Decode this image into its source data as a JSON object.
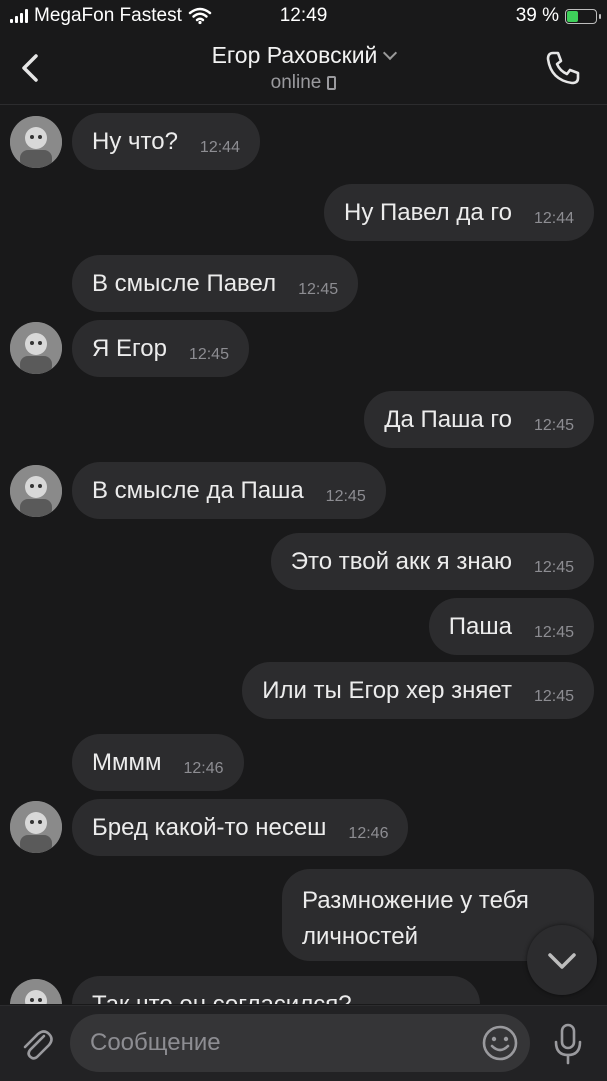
{
  "status_bar": {
    "carrier": "MegaFon Fastest",
    "time": "12:49",
    "battery_percent": "39 %",
    "battery_level": 0.39,
    "icons": [
      "signal-icon",
      "wifi-icon",
      "battery-icon"
    ]
  },
  "header": {
    "contact_name": "Егор Раховский",
    "status": "online",
    "icons": [
      "back-arrow-icon",
      "chevron-down-icon",
      "phone-device-icon",
      "call-icon"
    ]
  },
  "messages": [
    {
      "side": "in",
      "text": "Ну что?",
      "time": "12:44",
      "avatar": true
    },
    {
      "side": "out",
      "text": "Ну Павел да го",
      "time": "12:44"
    },
    {
      "side": "in",
      "text": "В смысле Павел",
      "time": "12:45"
    },
    {
      "side": "in",
      "text": "Я Егор",
      "time": "12:45",
      "avatar": true
    },
    {
      "side": "out",
      "text": "Да Паша го",
      "time": "12:45"
    },
    {
      "side": "in",
      "text": "В смысле да Паша",
      "time": "12:45",
      "avatar": true
    },
    {
      "side": "out",
      "text": "Это твой акк я знаю",
      "time": "12:45"
    },
    {
      "side": "out",
      "text": "Паша",
      "time": "12:45"
    },
    {
      "side": "out",
      "text": "Или ты Егор хер зняет",
      "time": "12:45"
    },
    {
      "side": "in",
      "text": "Мммм",
      "time": "12:46"
    },
    {
      "side": "in",
      "text": "Бред какой-то несеш",
      "time": "12:46",
      "avatar": true
    },
    {
      "side": "out",
      "text_lines": [
        "Размножение у тебя",
        "личностей"
      ]
    },
    {
      "side": "in",
      "text": "Так что он согласился?",
      "avatar": true
    }
  ],
  "composer": {
    "placeholder": "Сообщение",
    "icons": [
      "paperclip-icon",
      "emoji-icon",
      "microphone-icon",
      "scroll-down-icon"
    ]
  },
  "colors": {
    "background": "#19191a",
    "bubble": "#2c2c2e",
    "text": "#ececec",
    "time": "#8d8d92",
    "battery": "#3ed05a"
  }
}
